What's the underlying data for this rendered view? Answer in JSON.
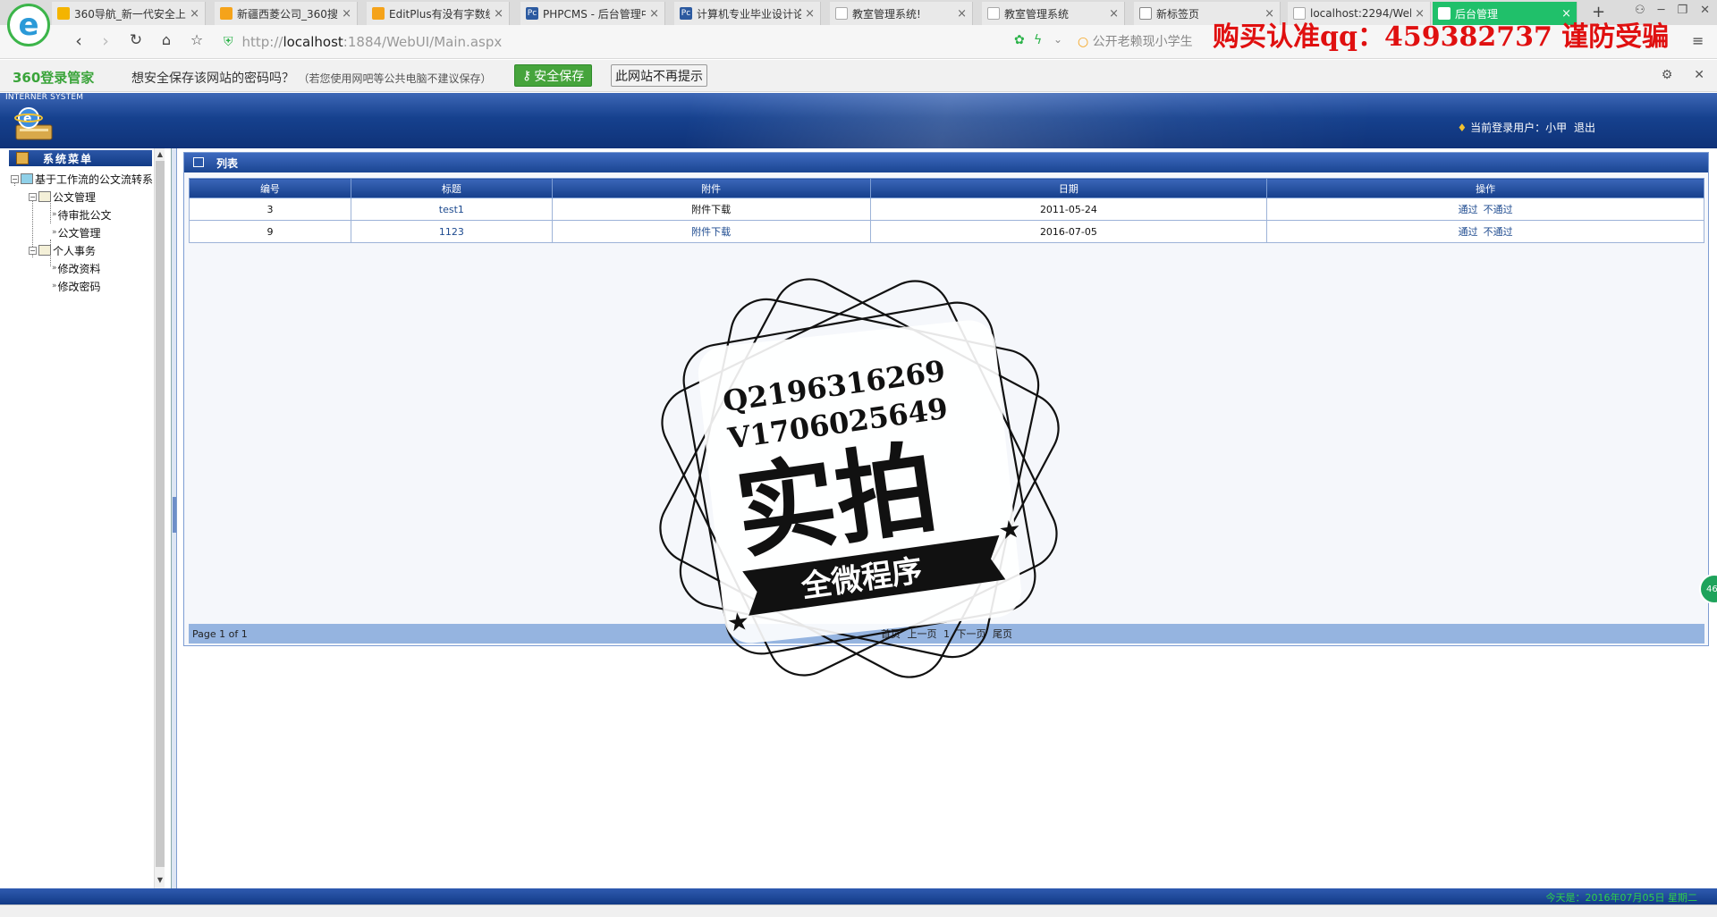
{
  "browser": {
    "tabs": [
      {
        "title": "360导航_新一代安全上",
        "icon_color": "#f4b400"
      },
      {
        "title": "新疆西菱公司_360搜索",
        "icon_color": "#f5a31a"
      },
      {
        "title": "EditPlus有没有字数统",
        "icon_color": "#f5a31a"
      },
      {
        "title": "PHPCMS - 后台管理中",
        "icon_color": "#2c5aa0"
      },
      {
        "title": "计算机专业毕业设计论",
        "icon_color": "#2c5aa0"
      },
      {
        "title": "教室管理系统!",
        "icon_color": "#aaaaaa"
      },
      {
        "title": "教室管理系统",
        "icon_color": "#aaaaaa"
      },
      {
        "title": "新标签页",
        "icon_color": "#888888"
      },
      {
        "title": "localhost:2294/WebU",
        "icon_color": "#aaaaaa"
      },
      {
        "title": "后台管理",
        "icon_color": "#ffffff"
      }
    ],
    "tab_close": "×",
    "new_tab": "+",
    "url_host": "localhost",
    "url_rest": ":1884/WebUI/Main.aspx",
    "url_scheme": "http://",
    "search_text": "公开老赖现小学生",
    "scam_banner": "购买认准qq：459382737 谨防受骗"
  },
  "password_bar": {
    "brand": "360登录管家",
    "message": "想安全保存该网站的密码吗？",
    "note": "（若您使用网吧等公共电脑不建议保存）",
    "save_label": "安全保存",
    "never_label": "此网站不再提示"
  },
  "app": {
    "system_label": "INTERNER SYSTEM",
    "user_prefix": "当前登录用户：",
    "user_name": "小甲",
    "logout": "退出",
    "menu_title": "系统菜单",
    "tree": {
      "root": "基于工作流的公文流转系",
      "doc_mgmt": "公文管理",
      "pending": "待审批公文",
      "doc_admin": "公文管理",
      "personal": "个人事务",
      "edit_profile": "修改资料",
      "edit_password": "修改密码"
    },
    "list_title": "列表",
    "columns": [
      "编号",
      "标题",
      "附件",
      "日期",
      "操作"
    ],
    "rows": [
      {
        "id": "3",
        "title": "test1",
        "attachment": "附件下载",
        "date": "2011-05-24",
        "approve": "通过",
        "reject": "不通过"
      },
      {
        "id": "9",
        "title": "1123",
        "attachment": "附件下载",
        "date": "2016-07-05",
        "approve": "通过",
        "reject": "不通过"
      }
    ],
    "pager": {
      "info": "Page 1 of 1",
      "first": "首页",
      "prev": "上一页",
      "current": "1",
      "next": "下一页",
      "last": "尾页"
    },
    "footer_date": "今天是：2016年07月05日 星期二"
  },
  "watermark": {
    "line1": "Q2196316269",
    "line2": "V1706025649",
    "main": "实拍",
    "ribbon": "全微程序"
  },
  "side_badge": "46"
}
